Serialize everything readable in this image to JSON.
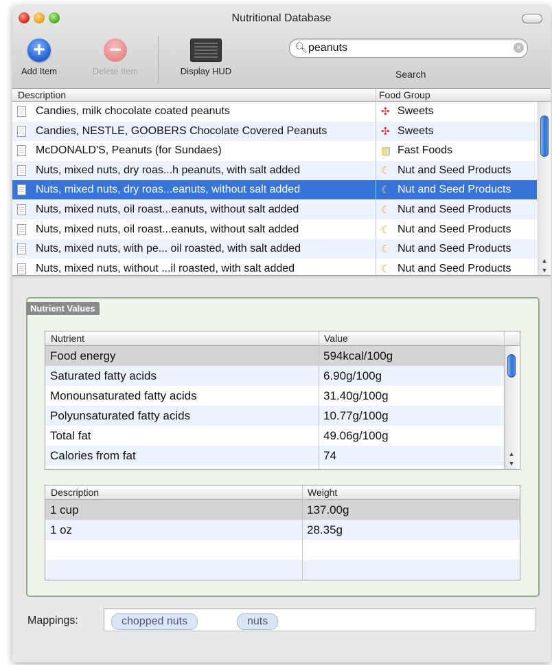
{
  "window": {
    "title": "Nutritional Database"
  },
  "toolbar": {
    "add_label": "Add Item",
    "delete_label": "Delete Item",
    "hud_label": "Display HUD",
    "search_value": "peanuts",
    "search_label": "Search"
  },
  "food_table": {
    "columns": [
      "Description",
      "Food Group"
    ],
    "rows": [
      {
        "description": "Candies, milk chocolate coated peanuts",
        "group": "Sweets",
        "group_icon": "candy-icon"
      },
      {
        "description": "Candies, NESTLE, GOOBERS Chocolate Covered Peanuts",
        "group": "Sweets",
        "group_icon": "candy-icon"
      },
      {
        "description": "McDONALD'S, Peanuts (for Sundaes)",
        "group": "Fast Foods",
        "group_icon": "fries-icon"
      },
      {
        "description": "Nuts, mixed nuts, dry roas...h peanuts, with salt added",
        "group": "Nut and Seed Products",
        "group_icon": "nut-icon"
      },
      {
        "description": "Nuts, mixed nuts, dry roas...eanuts, without salt added",
        "group": "Nut and Seed Products",
        "group_icon": "nut-icon"
      },
      {
        "description": "Nuts, mixed nuts, oil roast...eanuts, without salt added",
        "group": "Nut and Seed Products",
        "group_icon": "nut-icon"
      },
      {
        "description": "Nuts, mixed nuts, oil roast...eanuts, without salt added",
        "group": "Nut and Seed Products",
        "group_icon": "nut-icon"
      },
      {
        "description": "Nuts, mixed nuts, with pe... oil roasted, with salt added",
        "group": "Nut and Seed Products",
        "group_icon": "nut-icon"
      },
      {
        "description": "Nuts, mixed nuts, without ...il roasted, with salt added",
        "group": "Nut and Seed Products",
        "group_icon": "nut-icon"
      }
    ],
    "selected_index": 4
  },
  "nutrients": {
    "box_title": "Nutrient Values",
    "columns": [
      "Nutrient",
      "Value"
    ],
    "rows": [
      {
        "nutrient": "Food energy",
        "value": "594kcal/100g"
      },
      {
        "nutrient": "Saturated fatty acids",
        "value": "6.90g/100g"
      },
      {
        "nutrient": "Monounsaturated fatty acids",
        "value": "31.40g/100g"
      },
      {
        "nutrient": "Polyunsaturated fatty acids",
        "value": "10.77g/100g"
      },
      {
        "nutrient": "Total fat",
        "value": "49.06g/100g"
      },
      {
        "nutrient": "Calories from fat",
        "value": "74"
      }
    ]
  },
  "weights": {
    "columns": [
      "Description",
      "Weight"
    ],
    "rows": [
      {
        "description": "1 cup",
        "weight": "137.00g"
      },
      {
        "description": "1 oz",
        "weight": "28.35g"
      }
    ]
  },
  "mappings": {
    "label": "Mappings:",
    "tokens": [
      "chopped nuts",
      "nuts"
    ]
  },
  "colors": {
    "selection": "#3874d8",
    "alternate_row": "#edf3fe",
    "group_box": "#eef4ea"
  }
}
